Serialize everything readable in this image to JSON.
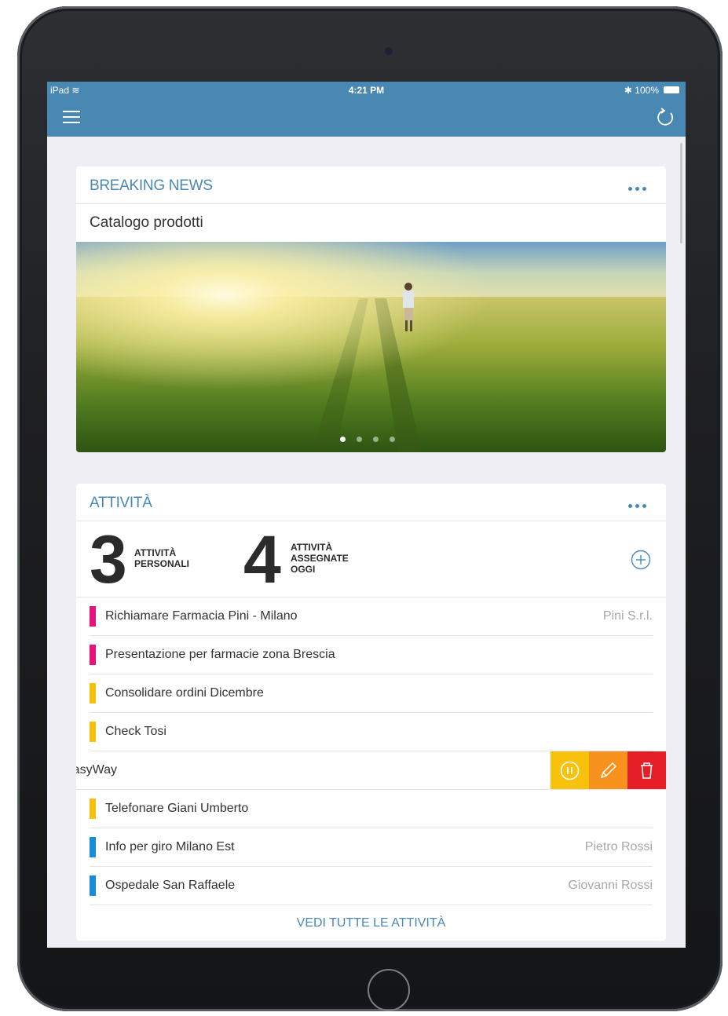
{
  "status_bar": {
    "device": "iPad",
    "time": "4:21 PM",
    "battery": "100%"
  },
  "colors": {
    "accent": "#4a88b4",
    "high_priority": "#e8127c",
    "medium_priority": "#f4c20d",
    "low_priority": "#1a8cd8",
    "action_pause": "#f8c10c",
    "action_edit": "#f7921e",
    "action_delete": "#e61e28"
  },
  "news": {
    "header": "BREAKING NEWS",
    "subtitle": "Catalogo prodotti",
    "image": "sunlit-field-person-walking",
    "pages": 4,
    "active_page": 1
  },
  "activities": {
    "header": "ATTIVITÀ",
    "personal_count": "3",
    "personal_label_1": "ATTIVITÀ",
    "personal_label_2": "PERSONALI",
    "assigned_count": "4",
    "assigned_label_1": "ATTIVITÀ",
    "assigned_label_2": "ASSEGNATE",
    "assigned_label_3": "OGGI",
    "tasks": [
      {
        "title": "Richiamare Farmacia Pini - Milano",
        "owner": "Pini S.r.l.",
        "priority": "high"
      },
      {
        "title": "Presentazione per farmacie zona Brescia",
        "owner": "",
        "priority": "high"
      },
      {
        "title": "Consolidare ordini Dicembre",
        "owner": "",
        "priority": "medium"
      },
      {
        "title": "Check Tosi",
        "owner": "",
        "priority": "medium"
      },
      {
        "title": "EasyWay",
        "owner": "",
        "priority": "none",
        "swiped": true
      },
      {
        "title": "Telefonare Giani Umberto",
        "owner": "",
        "priority": "medium"
      },
      {
        "title": "Info per giro Milano Est",
        "owner": "Pietro Rossi",
        "priority": "low"
      },
      {
        "title": "Ospedale San Raffaele",
        "owner": "Giovanni Rossi",
        "priority": "low"
      }
    ],
    "see_all": "VEDI TUTTE LE ATTIVITÀ"
  },
  "icons": {
    "menu": "hamburger-menu-icon",
    "refresh": "refresh-icon",
    "more": "more-dots-icon",
    "add": "add-circle-icon",
    "pause": "pause-icon",
    "edit": "pencil-icon",
    "delete": "trash-icon"
  }
}
